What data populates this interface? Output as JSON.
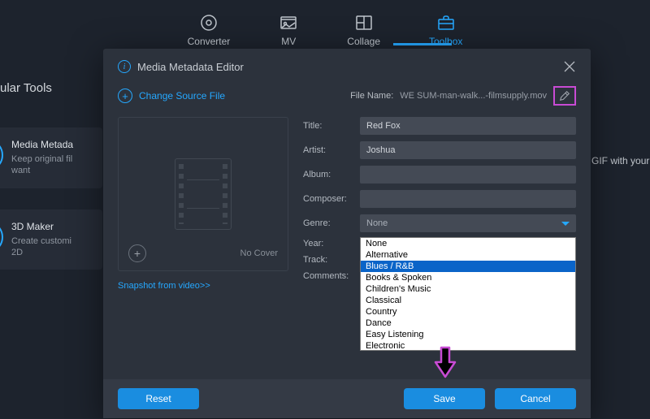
{
  "tabs": {
    "converter": "Converter",
    "mv": "MV",
    "collage": "Collage",
    "toolbox": "Toolbox"
  },
  "left": {
    "heading": "ular Tools",
    "card1_title": "Media Metada",
    "card1_desc": "Keep original fil\nwant",
    "card2_title": "3D Maker",
    "card2_desc": "Create customi\n2D",
    "card2_icon": "3D"
  },
  "right_fragment": "d GIF with your",
  "modal": {
    "title": "Media Metadata Editor",
    "change_source": "Change Source File",
    "file_name_label": "File Name:",
    "file_name_value": "WE SUM-man-walk...-filmsupply.mov",
    "no_cover": "No Cover",
    "snapshot": "Snapshot from video>>",
    "labels": {
      "title": "Title:",
      "artist": "Artist:",
      "album": "Album:",
      "composer": "Composer:",
      "genre": "Genre:",
      "year": "Year:",
      "track": "Track:",
      "comments": "Comments:"
    },
    "values": {
      "title": "Red Fox",
      "artist": "Joshua",
      "album": "",
      "composer": "",
      "genre": "None"
    },
    "genre_options": [
      "None",
      "Alternative",
      "Blues / R&B",
      "Books & Spoken",
      "Children's Music",
      "Classical",
      "Country",
      "Dance",
      "Easy Listening",
      "Electronic"
    ],
    "genre_selected_index": 2,
    "buttons": {
      "reset": "Reset",
      "save": "Save",
      "cancel": "Cancel"
    }
  }
}
